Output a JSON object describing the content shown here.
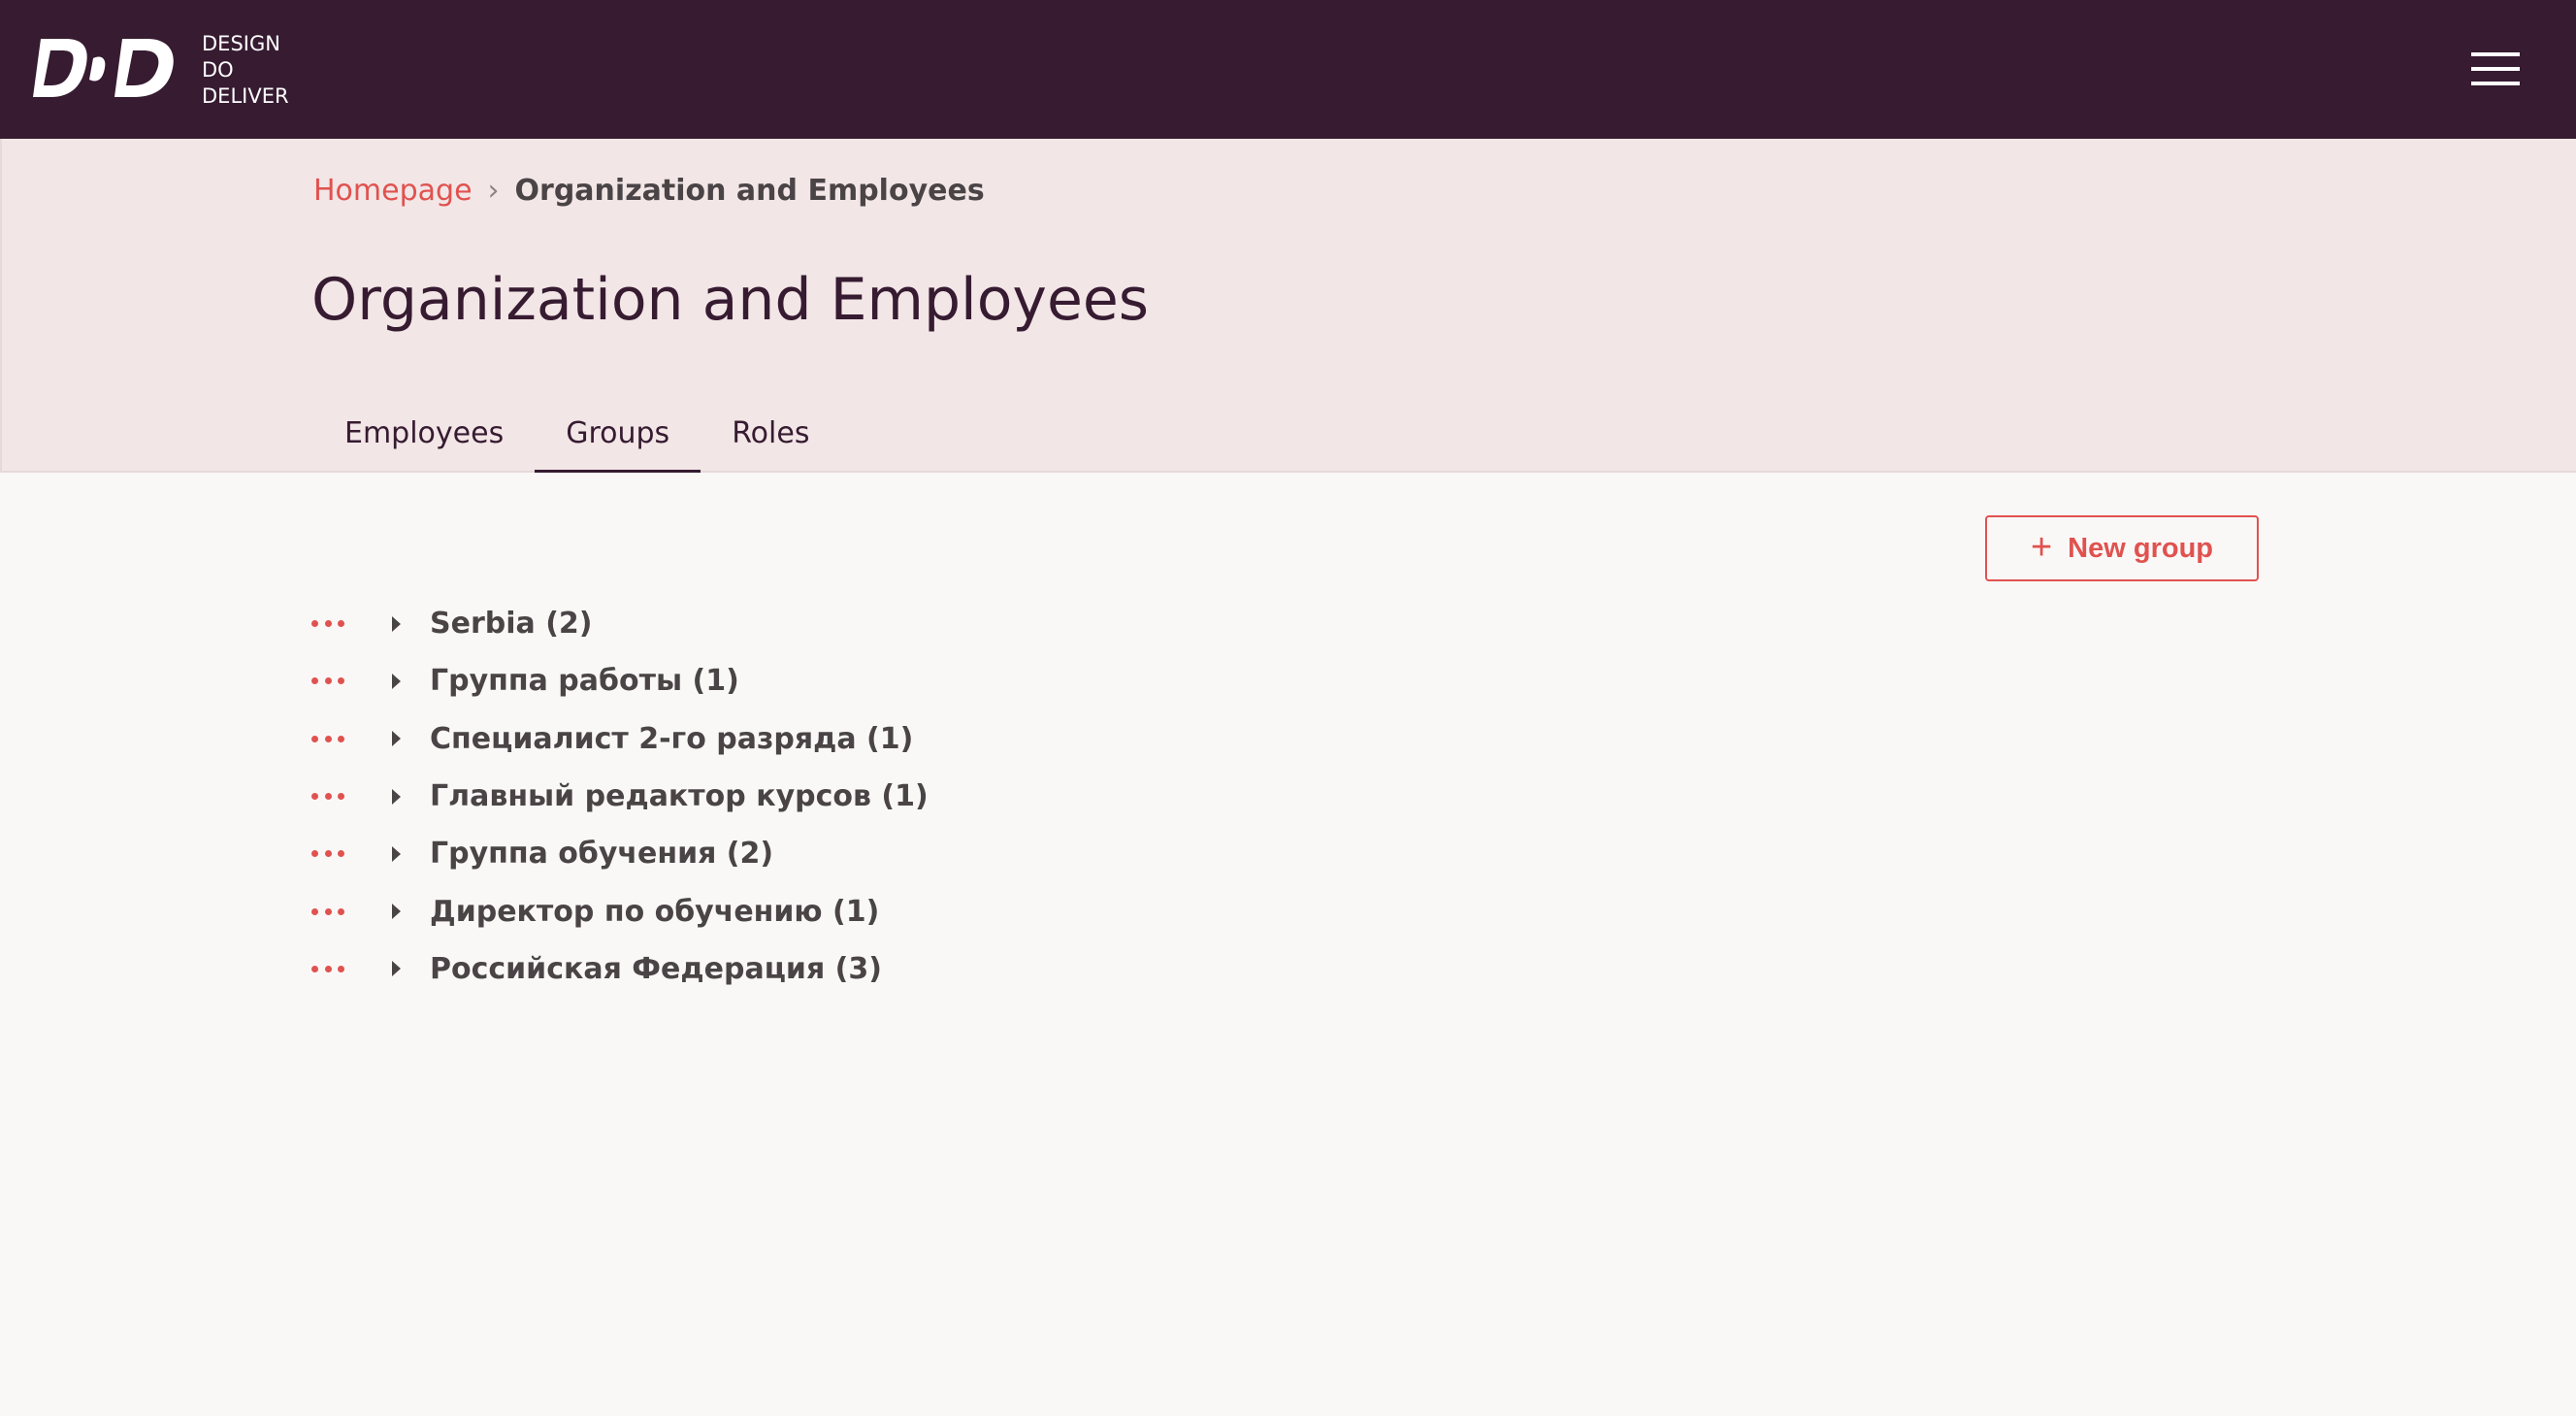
{
  "app": {
    "logo_lines": [
      "DESIGN",
      "DO",
      "DELIVER"
    ]
  },
  "header": {
    "breadcrumb": {
      "home": "Homepage",
      "separator": "›",
      "current": "Organization and Employees"
    },
    "title": "Organization and Employees",
    "tabs": [
      {
        "label": "Employees",
        "active": false
      },
      {
        "label": "Groups",
        "active": true
      },
      {
        "label": "Roles",
        "active": false
      }
    ]
  },
  "actions": {
    "new_group_icon": "+",
    "new_group_label": "New group"
  },
  "groups": [
    {
      "name": "Serbia (2)"
    },
    {
      "name": "Группа работы (1)"
    },
    {
      "name": "Специалист 2-го разряда (1)"
    },
    {
      "name": "Главный редактор курсов (1)"
    },
    {
      "name": "Группа обучения (2)"
    },
    {
      "name": "Директор по обучению (1)"
    },
    {
      "name": "Российская Федерация (3)"
    }
  ],
  "colors": {
    "topbar": "#361b31",
    "accent": "#e0524f",
    "header_band": "#f2e6e6",
    "text": "#4a4447"
  }
}
